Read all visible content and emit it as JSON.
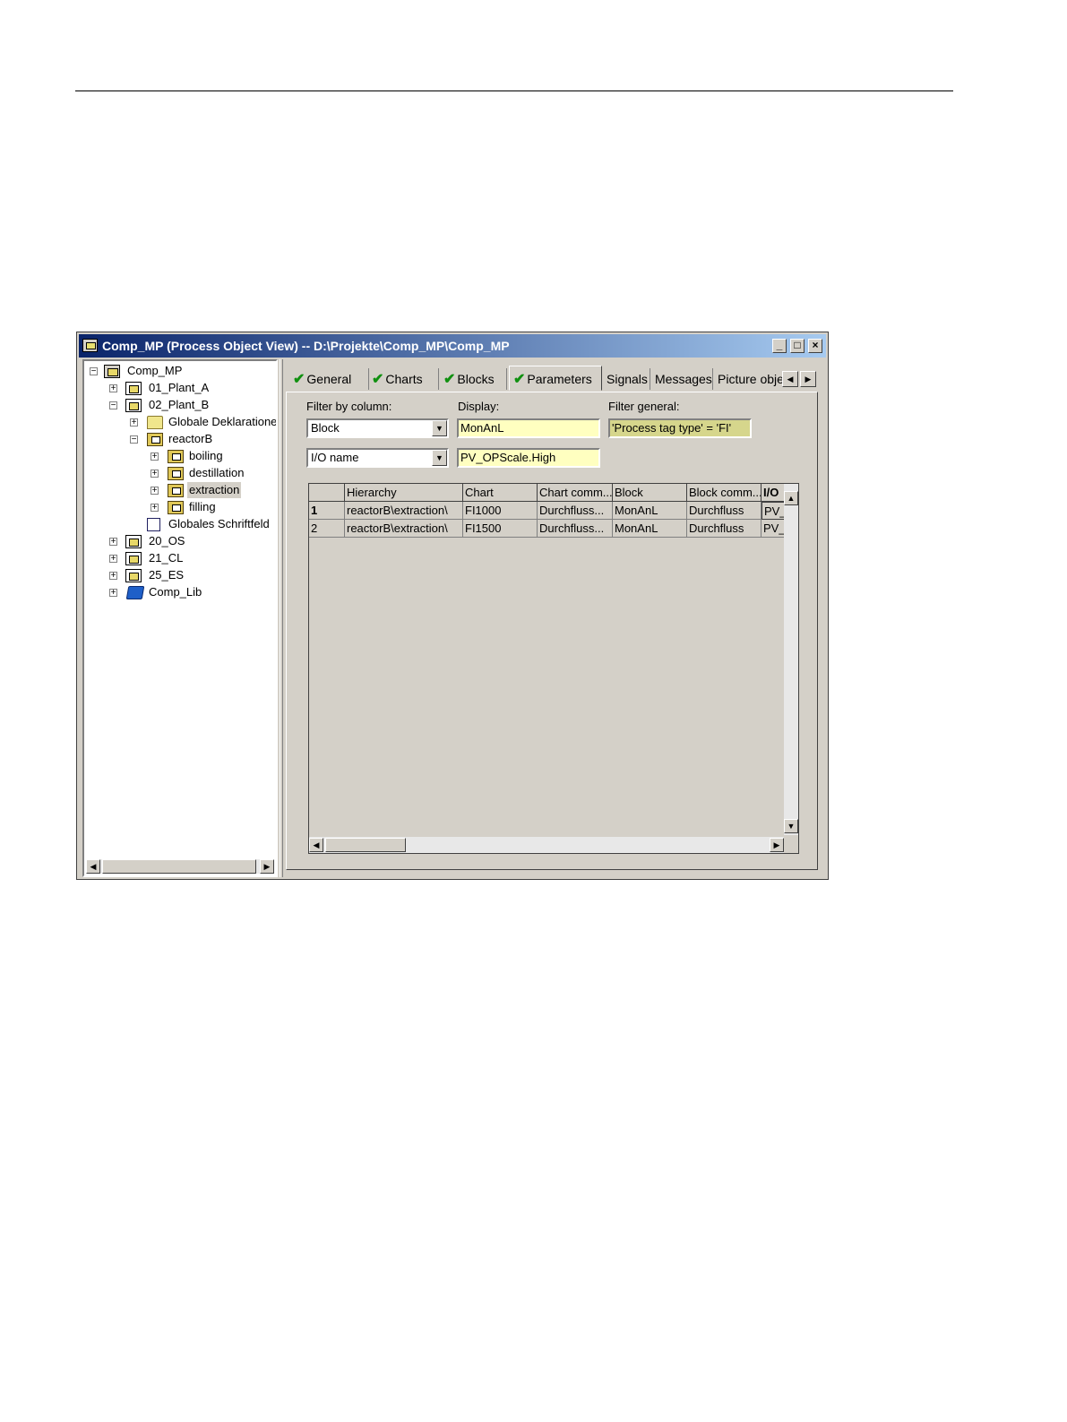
{
  "window": {
    "title": "Comp_MP (Process Object View) -- D:\\Projekte\\Comp_MP\\Comp_MP",
    "minimize": "_",
    "maximize": "□",
    "close": "×"
  },
  "tree": {
    "root": "Comp_MP",
    "plant_a": "01_Plant_A",
    "plant_b": "02_Plant_B",
    "globale_deklarationen": "Globale Deklarationen",
    "reactor_b": "reactorB",
    "boiling": "boiling",
    "destillation": "destillation",
    "extraction": "extraction",
    "filling": "filling",
    "schriftfeld": "Globales Schriftfeld",
    "os": "20_OS",
    "cl": "21_CL",
    "es": "25_ES",
    "lib": "Comp_Lib",
    "expand": "+",
    "collapse": "−"
  },
  "tabs": {
    "general": "General",
    "charts": "Charts",
    "blocks": "Blocks",
    "parameters": "Parameters",
    "signals": "Signals",
    "messages": "Messages",
    "picture": "Picture objec",
    "check": "✔",
    "scroll_left": "◀",
    "scroll_right": "▶"
  },
  "filter": {
    "by_column_label": "Filter by column:",
    "display_label": "Display:",
    "general_label": "Filter general:",
    "column1": "Block",
    "value1": "MonAnL",
    "column2": "I/O name",
    "value2": "PV_OPScale.High",
    "general_value": "'Process tag type' = 'FI'",
    "arrow": "▼"
  },
  "table": {
    "headers": [
      "",
      "Hierarchy",
      "Chart",
      "Chart comm...",
      "Block",
      "Block comm...",
      "I/O"
    ],
    "rows": [
      [
        "1",
        "reactorB\\extraction\\",
        "FI1000",
        "Durchfluss...",
        "MonAnL",
        "Durchfluss",
        "PV_"
      ],
      [
        "2",
        "reactorB\\extraction\\",
        "FI1500",
        "Durchfluss...",
        "MonAnL",
        "Durchfluss",
        "PV_"
      ]
    ],
    "scroll_up": "▲",
    "scroll_down": "▼",
    "scroll_left": "◀",
    "scroll_right": "▶"
  }
}
